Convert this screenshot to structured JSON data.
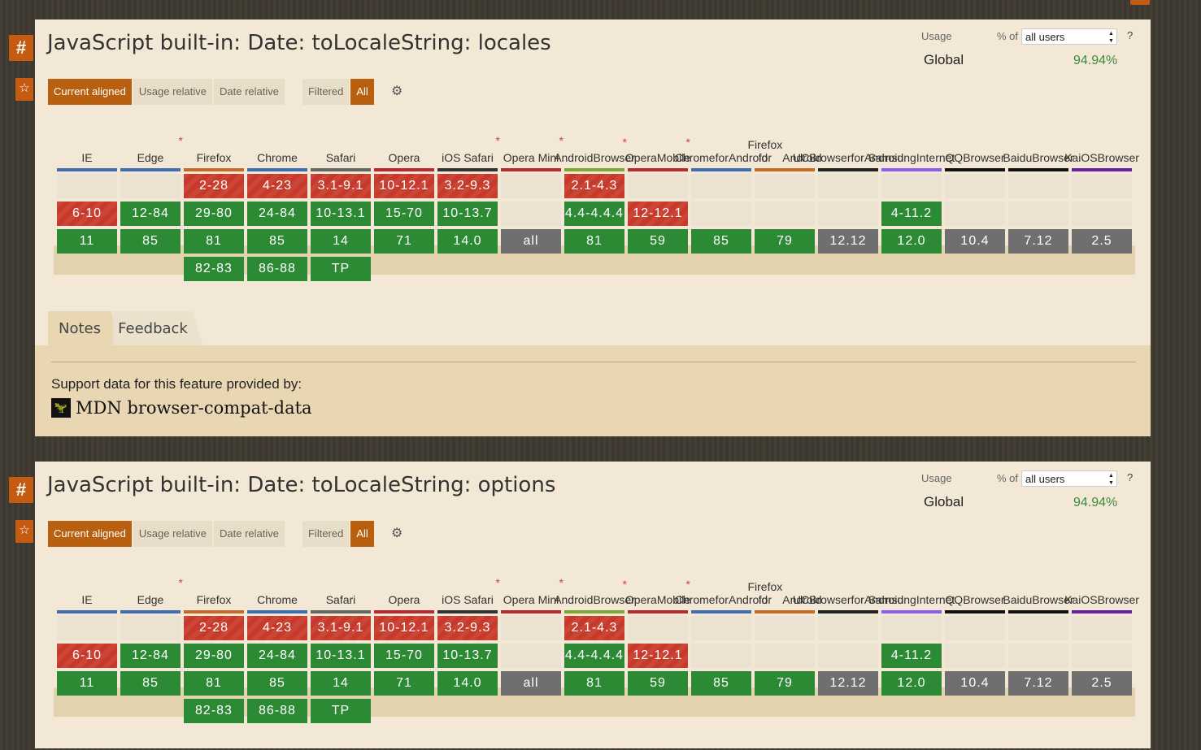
{
  "features": [
    {
      "title": "JavaScript built-in: Date: toLocaleString: locales",
      "hash": "#",
      "star": "☆",
      "usage_label": "Usage",
      "pct_of": "% of",
      "user_select": "all users",
      "help": "?",
      "global_label": "Global",
      "global_pct": "94.94%",
      "buttons": [
        "Current aligned",
        "Usage relative",
        "Date relative"
      ],
      "filter_buttons": [
        "Filtered",
        "All"
      ],
      "gear_icon": "settings-gear-icon",
      "has_notes": true
    },
    {
      "title": "JavaScript built-in: Date: toLocaleString: options",
      "hash": "#",
      "star": "☆",
      "usage_label": "Usage",
      "pct_of": "% of",
      "user_select": "all users",
      "help": "?",
      "global_label": "Global",
      "global_pct": "94.94%",
      "buttons": [
        "Current aligned",
        "Usage relative",
        "Date relative"
      ],
      "filter_buttons": [
        "Filtered",
        "All"
      ],
      "gear_icon": "settings-gear-icon",
      "has_notes": false
    }
  ],
  "browsers": [
    {
      "name": [
        "IE"
      ],
      "color": "#3d6eb0",
      "asterisk": false,
      "cells": [
        {
          "v": "",
          "s": "e"
        },
        {
          "v": "6-10",
          "s": "n"
        },
        {
          "v": "11",
          "s": "y"
        },
        null
      ]
    },
    {
      "name": [
        "Edge"
      ],
      "color": "#3d6eb0",
      "asterisk": true,
      "cells": [
        {
          "v": "",
          "s": "e"
        },
        {
          "v": "12-84",
          "s": "y"
        },
        {
          "v": "85",
          "s": "y"
        },
        null
      ]
    },
    {
      "name": [
        "Firefox"
      ],
      "color": "#c46a22",
      "asterisk": false,
      "cells": [
        {
          "v": "2-28",
          "s": "n"
        },
        {
          "v": "29-80",
          "s": "y"
        },
        {
          "v": "81",
          "s": "y"
        },
        {
          "v": "82-83",
          "s": "y"
        }
      ]
    },
    {
      "name": [
        "Chrome"
      ],
      "color": "#3d6eb0",
      "asterisk": false,
      "cells": [
        {
          "v": "4-23",
          "s": "n"
        },
        {
          "v": "24-84",
          "s": "y"
        },
        {
          "v": "85",
          "s": "y"
        },
        {
          "v": "86-88",
          "s": "y"
        }
      ]
    },
    {
      "name": [
        "Safari"
      ],
      "color": "#666666",
      "asterisk": false,
      "cells": [
        {
          "v": "3.1-9.1",
          "s": "n"
        },
        {
          "v": "10-13.1",
          "s": "y"
        },
        {
          "v": "14",
          "s": "y"
        },
        {
          "v": "TP",
          "s": "y"
        }
      ]
    },
    {
      "name": [
        "Opera"
      ],
      "color": "#b8282e",
      "asterisk": false,
      "cells": [
        {
          "v": "10-12.1",
          "s": "n"
        },
        {
          "v": "15-70",
          "s": "y"
        },
        {
          "v": "71",
          "s": "y"
        },
        null
      ]
    },
    {
      "name": [
        "iOS Safari"
      ],
      "color": "#333333",
      "asterisk": true,
      "cells": [
        {
          "v": "3.2-9.3",
          "s": "n"
        },
        {
          "v": "10-13.7",
          "s": "y"
        },
        {
          "v": "14.0",
          "s": "y"
        },
        null
      ]
    },
    {
      "name": [
        "Opera Mini"
      ],
      "color": "#b8282e",
      "asterisk": true,
      "cells": [
        {
          "v": "",
          "s": "e"
        },
        {
          "v": "",
          "s": "e"
        },
        {
          "v": "all",
          "s": "u"
        },
        null
      ]
    },
    {
      "name": [
        "Android",
        "Browser"
      ],
      "color": "#7fa830",
      "asterisk": true,
      "cells": [
        {
          "v": "2.1-4.3",
          "s": "n"
        },
        {
          "v": "4.4-4.4.4",
          "s": "y"
        },
        {
          "v": "81",
          "s": "y"
        },
        null
      ]
    },
    {
      "name": [
        "Opera",
        "Mobile"
      ],
      "color": "#b8282e",
      "asterisk": true,
      "cells": [
        {
          "v": "",
          "s": "e"
        },
        {
          "v": "12-12.1",
          "s": "n"
        },
        {
          "v": "59",
          "s": "y"
        },
        null
      ]
    },
    {
      "name": [
        "Chrome",
        "for",
        "Android"
      ],
      "color": "#3d6eb0",
      "asterisk": false,
      "cells": [
        {
          "v": "",
          "s": "e"
        },
        {
          "v": "",
          "s": "e"
        },
        {
          "v": "85",
          "s": "y"
        },
        null
      ]
    },
    {
      "name": [
        "Firefox for",
        "Android"
      ],
      "color": "#c46a22",
      "asterisk": false,
      "cells": [
        {
          "v": "",
          "s": "e"
        },
        {
          "v": "",
          "s": "e"
        },
        {
          "v": "79",
          "s": "y"
        },
        null
      ]
    },
    {
      "name": [
        "UC",
        "Browser",
        "for",
        "Android"
      ],
      "color": "#222222",
      "asterisk": false,
      "cells": [
        {
          "v": "",
          "s": "e"
        },
        {
          "v": "",
          "s": "e"
        },
        {
          "v": "12.12",
          "s": "u"
        },
        null
      ]
    },
    {
      "name": [
        "Samsung",
        "Internet"
      ],
      "color": "#8b5cf0",
      "asterisk": false,
      "cells": [
        {
          "v": "",
          "s": "e"
        },
        {
          "v": "4-11.2",
          "s": "y"
        },
        {
          "v": "12.0",
          "s": "y"
        },
        null
      ]
    },
    {
      "name": [
        "QQ",
        "Browser"
      ],
      "color": "#111111",
      "asterisk": false,
      "cells": [
        {
          "v": "",
          "s": "e"
        },
        {
          "v": "",
          "s": "e"
        },
        {
          "v": "10.4",
          "s": "u"
        },
        null
      ]
    },
    {
      "name": [
        "Baidu",
        "Browser"
      ],
      "color": "#111111",
      "asterisk": false,
      "cells": [
        {
          "v": "",
          "s": "e"
        },
        {
          "v": "",
          "s": "e"
        },
        {
          "v": "7.12",
          "s": "u"
        },
        null
      ]
    },
    {
      "name": [
        "KaiOS",
        "Browser"
      ],
      "color": "#6a1fa0",
      "asterisk": false,
      "cells": [
        {
          "v": "",
          "s": "e"
        },
        {
          "v": "",
          "s": "e"
        },
        {
          "v": "2.5",
          "s": "u"
        },
        null
      ]
    }
  ],
  "tabs": {
    "notes": "Notes",
    "feedback": "Feedback"
  },
  "notes": {
    "provided_by": "Support data for this feature provided by:",
    "mdn_label": "MDN browser-compat-data",
    "mdn_icon": "mdn-dino-icon"
  }
}
